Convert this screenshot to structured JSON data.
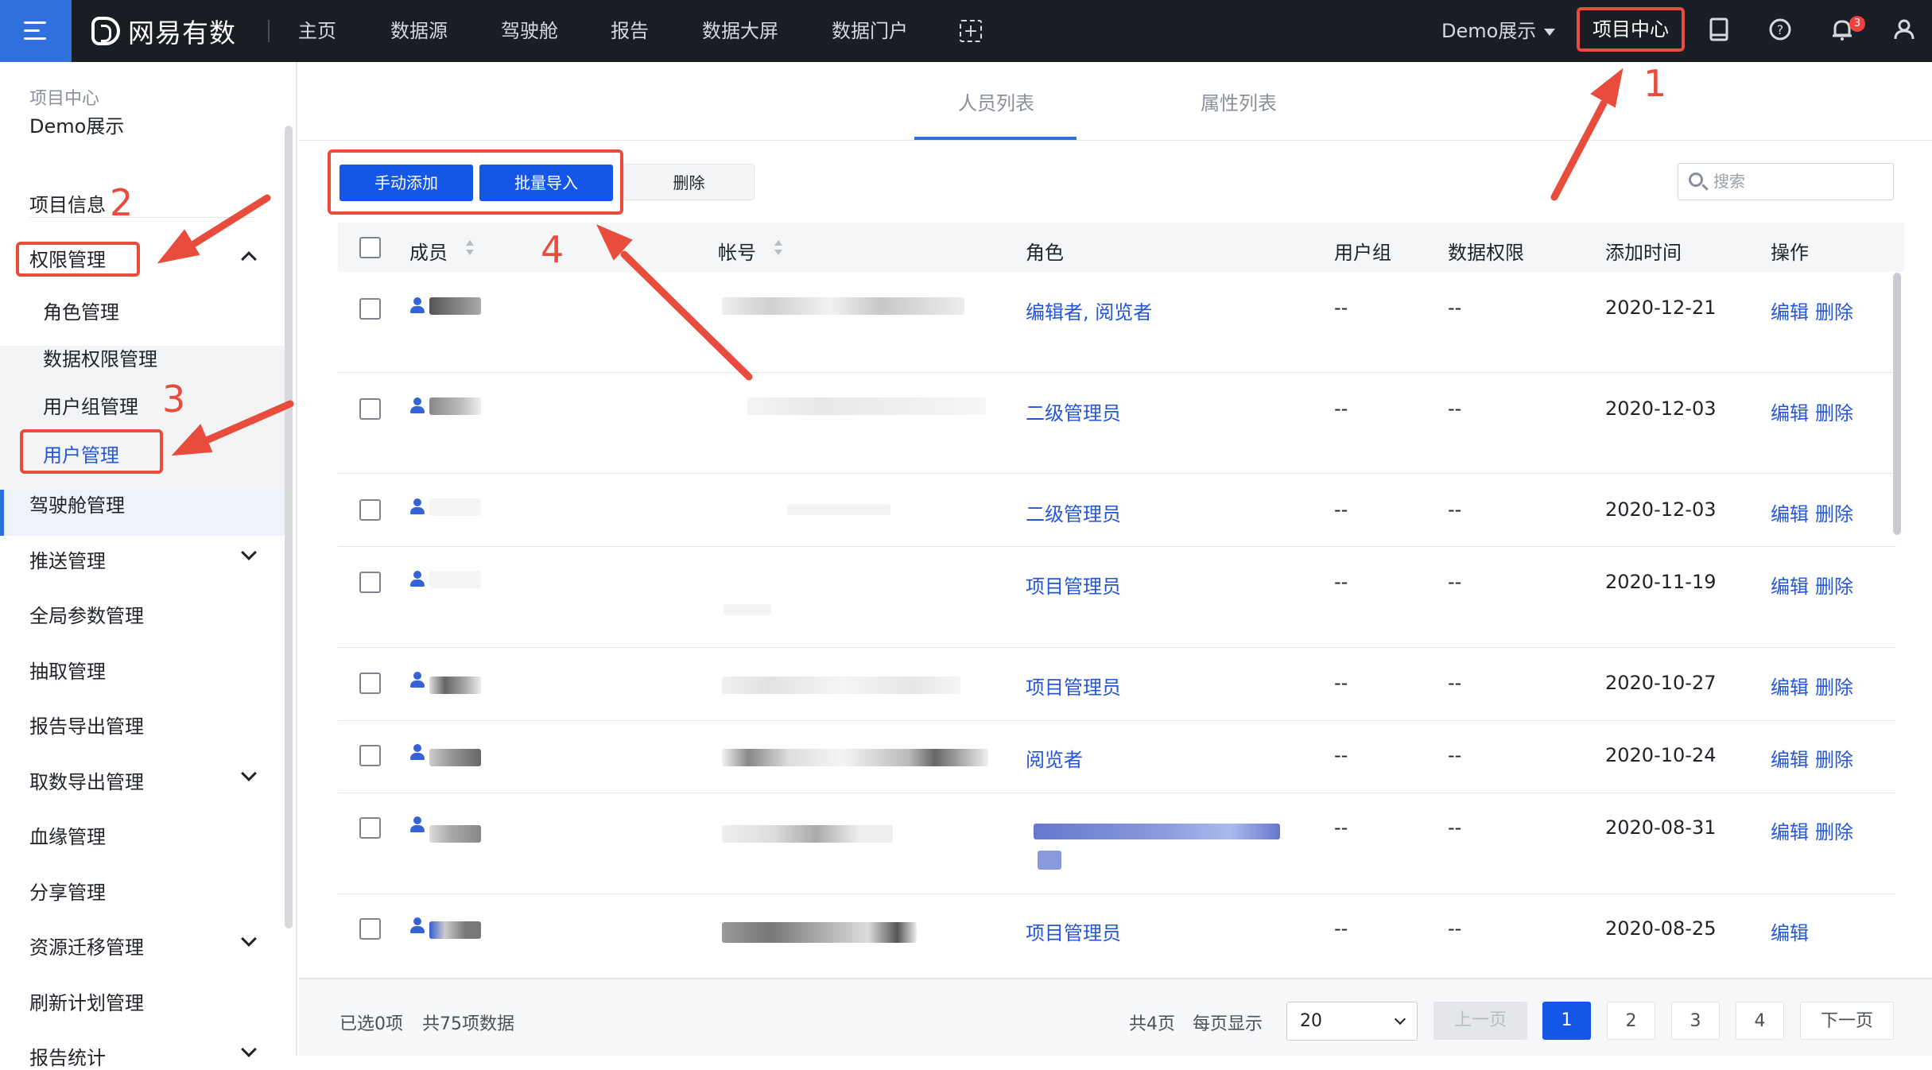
{
  "topbar": {
    "brand": "网易有数",
    "nav": [
      "主页",
      "数据源",
      "驾驶舱",
      "报告",
      "数据大屏",
      "数据门户"
    ],
    "demo_label": "Demo展示",
    "project_center": "项目中心",
    "notification_count": "3"
  },
  "sidebar": {
    "title": "项目中心",
    "project": "Demo展示",
    "items": {
      "info": "项目信息",
      "perm": "权限管理",
      "role": "角色管理",
      "dataperm": "数据权限管理",
      "usergroup": "用户组管理",
      "user": "用户管理",
      "cockpit": "驾驶舱管理",
      "push": "推送管理",
      "global": "全局参数管理",
      "extract": "抽取管理",
      "report_export": "报告导出管理",
      "data_export": "取数导出管理",
      "lineage": "血缘管理",
      "share": "分享管理",
      "migrate": "资源迁移管理",
      "refresh": "刷新计划管理",
      "stats": "报告统计"
    }
  },
  "tabs": {
    "members": "人员列表",
    "attrs": "属性列表"
  },
  "toolbar": {
    "add": "手动添加",
    "import": "批量导入",
    "delete": "删除",
    "search_placeholder": "搜索"
  },
  "table": {
    "headers": {
      "member": "成员",
      "account": "帐号",
      "role": "角色",
      "group": "用户组",
      "dataperm": "数据权限",
      "added": "添加时间",
      "ops": "操作"
    },
    "rows": [
      {
        "role": "编辑者, 阅览者",
        "group": "--",
        "perm": "--",
        "date": "2020-12-21",
        "edit": "编辑",
        "del": "删除"
      },
      {
        "role": "二级管理员",
        "group": "--",
        "perm": "--",
        "date": "2020-12-03",
        "edit": "编辑",
        "del": "删除"
      },
      {
        "role": "二级管理员",
        "group": "--",
        "perm": "--",
        "date": "2020-12-03",
        "edit": "编辑",
        "del": "删除"
      },
      {
        "role": "项目管理员",
        "group": "--",
        "perm": "--",
        "date": "2020-11-19",
        "edit": "编辑",
        "del": "删除"
      },
      {
        "role": "项目管理员",
        "group": "--",
        "perm": "--",
        "date": "2020-10-27",
        "edit": "编辑",
        "del": "删除"
      },
      {
        "role": "阅览者",
        "group": "--",
        "perm": "--",
        "date": "2020-10-24",
        "edit": "编辑",
        "del": "删除"
      },
      {
        "role": "",
        "group": "--",
        "perm": "--",
        "date": "2020-08-31",
        "edit": "编辑",
        "del": "删除"
      },
      {
        "role": "项目管理员",
        "group": "--",
        "perm": "--",
        "date": "2020-08-25",
        "edit": "编辑",
        "del": ""
      }
    ]
  },
  "footer": {
    "selected": "已选0项",
    "total": "共75项数据",
    "pages": "共4页",
    "per_page_label": "每页显示",
    "per_page": "20",
    "prev": "上一页",
    "next": "下一页",
    "page_numbers": [
      "1",
      "2",
      "3",
      "4"
    ]
  },
  "annotations": [
    "1",
    "2",
    "3",
    "4"
  ],
  "colors": {
    "accent": "#1457e6",
    "annotation": "#e74c3c",
    "topbar": "#1a1d24"
  }
}
